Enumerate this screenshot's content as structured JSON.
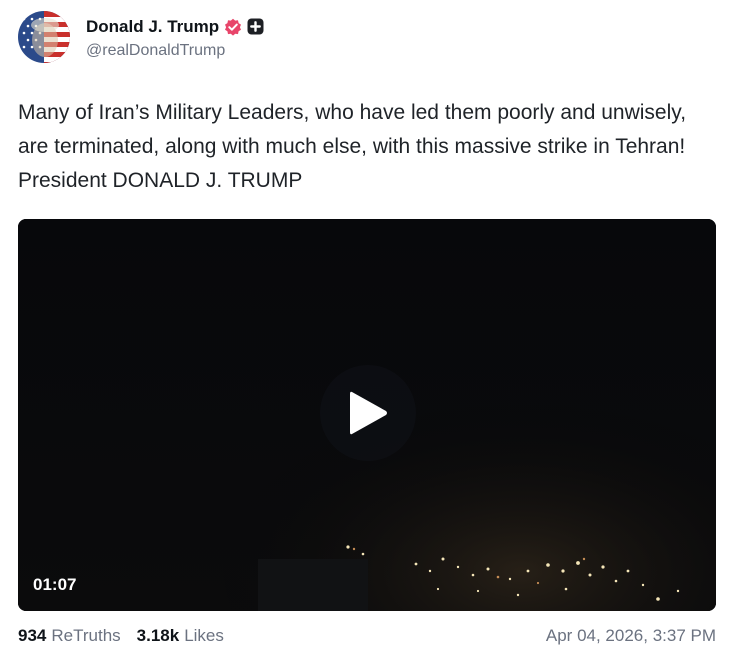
{
  "post": {
    "author": {
      "display_name": "Donald J. Trump",
      "handle": "@realDonaldTrump",
      "verified_icon": "verified-badge-icon",
      "plus_icon": "plus-badge-icon"
    },
    "text": "Many of Iran’s Military Leaders, who have led them poorly and unwisely, are terminated, along with much else, with this massive strike in Tehran! President DONALD J. TRUMP",
    "video": {
      "duration": "01:07",
      "play_icon": "play-icon"
    },
    "stats": {
      "retruths_count": "934",
      "retruths_label": "ReTruths",
      "likes_count": "3.18k",
      "likes_label": "Likes"
    },
    "timestamp": "Apr 04, 2026, 3:37 PM"
  },
  "colors": {
    "text_primary": "#0f1419",
    "text_secondary": "#6b7280",
    "verified_badge": "#e8456a",
    "video_bg": "#050608"
  }
}
